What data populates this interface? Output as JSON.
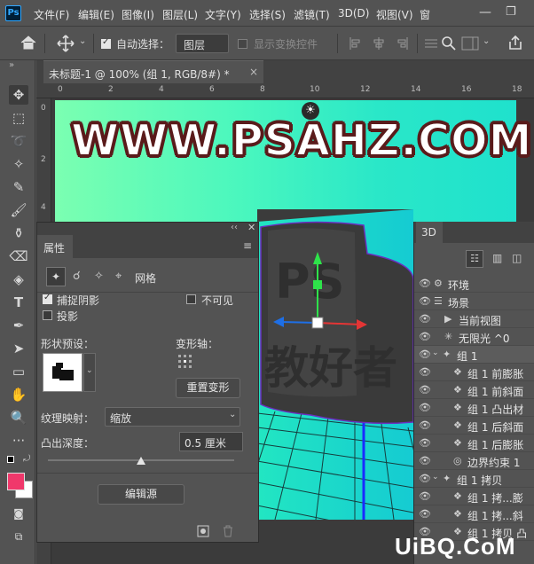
{
  "app": {
    "logo": "Ps"
  },
  "menu": [
    "文件(F)",
    "编辑(E)",
    "图像(I)",
    "图层(L)",
    "文字(Y)",
    "选择(S)",
    "滤镜(T)",
    "3D(D)",
    "视图(V)",
    "窗"
  ],
  "window_controls": {
    "minimize": "—",
    "restore": "❐"
  },
  "options": {
    "auto_select_label": "自动选择：",
    "auto_select_checked": true,
    "auto_select_target": "图层",
    "show_transform_label": "显示变换控件",
    "show_transform_checked": false
  },
  "doc_tab": {
    "title": "未标题-1 @ 100% (组 1, RGB/8#) *",
    "close": "×"
  },
  "ruler_h": [
    "0",
    "2",
    "4",
    "6",
    "8",
    "10",
    "12",
    "14",
    "16",
    "18"
  ],
  "ruler_v": [
    "0",
    "2",
    "4"
  ],
  "canvas": {
    "banner_text": "WWW.PSAHZ.COM",
    "gradient_start": "#7bffb1",
    "gradient_end": "#1fe1cd",
    "text_outline": "#5a1b1b",
    "object_color": "#3a3a3a"
  },
  "properties": {
    "title": "属性",
    "mesh_tab": "网格",
    "catch_shadows": {
      "label": "捕捉阴影",
      "checked": true
    },
    "invisible": {
      "label": "不可见",
      "checked": false
    },
    "cast_shadows": {
      "label": "投影",
      "checked": false
    },
    "shape_preset_label": "形状预设：",
    "deform_axis_label": "变形轴：",
    "reset_deform": "重置变形",
    "texture_mapping_label": "纹理映射：",
    "texture_mapping_value": "缩放",
    "extrusion_depth_label": "凸出深度：",
    "extrusion_depth_value": "0.5 厘米",
    "extrusion_slider_fraction": 0.5,
    "edit_source": "编辑源"
  },
  "panel3d": {
    "title": "3D",
    "rows": [
      {
        "label": "环境",
        "icon": "environment-icon",
        "indent": 0
      },
      {
        "label": "场景",
        "icon": "scene-icon",
        "indent": 0
      },
      {
        "label": "当前视图",
        "icon": "camera-icon",
        "indent": 1
      },
      {
        "label": "无限光 ^0",
        "icon": "light-icon",
        "indent": 1
      },
      {
        "label": "组 1",
        "icon": "group-icon",
        "indent": 0,
        "expanded": true,
        "selected": true
      },
      {
        "label": "组 1 前膨胀",
        "icon": "material-icon",
        "indent": 2
      },
      {
        "label": "组 1 前斜面",
        "icon": "material-icon",
        "indent": 2
      },
      {
        "label": "组 1 凸出材",
        "icon": "material-icon",
        "indent": 2
      },
      {
        "label": "组 1 后斜面",
        "icon": "material-icon",
        "indent": 2
      },
      {
        "label": "组 1 后膨胀",
        "icon": "material-icon",
        "indent": 2
      },
      {
        "label": "边界约束 1",
        "icon": "constraint-icon",
        "indent": 2
      },
      {
        "label": "组 1 拷贝",
        "icon": "group-icon",
        "indent": 0,
        "expanded": true
      },
      {
        "label": "组 1 拷...膨",
        "icon": "material-icon",
        "indent": 2
      },
      {
        "label": "组 1 拷...斜",
        "icon": "material-icon",
        "indent": 2
      },
      {
        "label": "组 1 拷贝 凸",
        "icon": "material-icon",
        "indent": 2
      }
    ]
  },
  "brand_watermark": "UiBQ.CoM"
}
